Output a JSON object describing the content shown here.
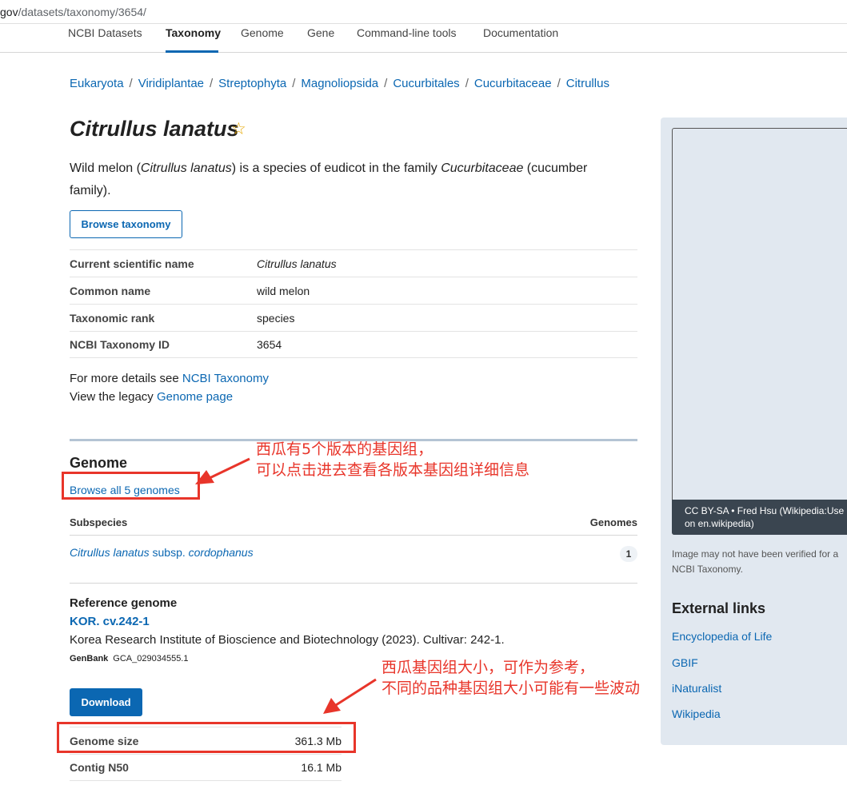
{
  "browser": {
    "url_prefix": "gov",
    "url_rest": "/datasets/taxonomy/3654/"
  },
  "nav": {
    "tabs": [
      "NCBI Datasets",
      "Taxonomy",
      "Genome",
      "Gene",
      "Command-line tools",
      "Documentation"
    ],
    "active": "Taxonomy"
  },
  "breadcrumb": [
    "Eukaryota",
    "Viridiplantae",
    "Streptophyta",
    "Magnoliopsida",
    "Cucurbitales",
    "Cucurbitaceae",
    "Citrullus"
  ],
  "title": "Citrullus lanatus",
  "description": {
    "p1": "Wild melon (",
    "i1": "Citrullus lanatus",
    "p2": ") is a species of eudicot in the family ",
    "i2": "Cucurbitaceae",
    "p3": " (cucumber family)."
  },
  "browse_taxonomy_label": "Browse taxonomy",
  "taxonomy_table": [
    {
      "key": "Current scientific name",
      "value": "Citrullus lanatus",
      "italic": true
    },
    {
      "key": "Common name",
      "value": "wild melon"
    },
    {
      "key": "Taxonomic rank",
      "value": "species"
    },
    {
      "key": "NCBI Taxonomy ID",
      "value": "3654"
    }
  ],
  "more_details": {
    "line1_text": "For more details see ",
    "line1_link": "NCBI Taxonomy",
    "line2_text": "View the legacy ",
    "line2_link": "Genome page"
  },
  "genome": {
    "heading": "Genome",
    "browse_all": "Browse all 5 genomes",
    "subspecies_header": "Subspecies",
    "genomes_header": "Genomes",
    "subspecies_name": "Citrullus lanatus",
    "subspecies_mid": " subsp. ",
    "subspecies_epithet": "cordophanus",
    "subspecies_count": "1"
  },
  "reference": {
    "heading": "Reference genome",
    "name": "KOR. cv.242-1",
    "description": "Korea Research Institute of Bioscience and Biotechnology (2023). Cultivar: 242-1.",
    "accession_label": "GenBank",
    "accession": "GCA_029034555.1",
    "download_label": "Download"
  },
  "stats": [
    {
      "key": "Genome size",
      "value": "361.3 Mb"
    },
    {
      "key": "Contig N50",
      "value": "16.1 Mb"
    }
  ],
  "sidebar": {
    "credit_line1": "CC BY-SA  •  Fred Hsu (Wikipedia:Use",
    "credit_line2": "on en.wikipedia)",
    "verify_line1": "Image may not have been verified for a",
    "verify_line2": "NCBI Taxonomy.",
    "external_links_heading": "External links",
    "external_links": [
      "Encyclopedia of Life",
      "GBIF",
      "iNaturalist",
      "Wikipedia"
    ]
  },
  "annotations": {
    "note1_line1": "西瓜有5个版本的基因组，",
    "note1_line2": "可以点击进去查看各版本基因组详细信息",
    "note2_line1": "西瓜基因组大小，可作为参考，",
    "note2_line2": "不同的品种基因组大小可能有一些波动",
    "color": "#e8352a"
  },
  "colors": {
    "link": "#0b67b2",
    "star": "#e6a700",
    "sidebar_bg": "#e1e8f0"
  }
}
